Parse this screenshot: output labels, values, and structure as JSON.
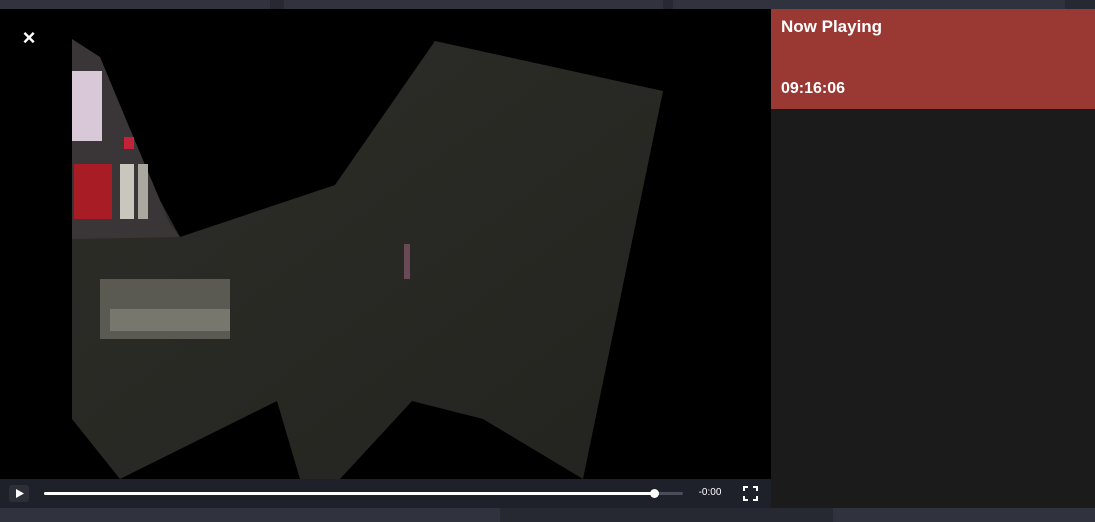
{
  "player": {
    "close_label": "×",
    "time_remaining": "-0:00",
    "progress": 0.955,
    "colors": {
      "controls_bg": "#1e2129",
      "track": "#4a4e5a",
      "fill": "#ffffff"
    },
    "icons": {
      "close": "close-icon",
      "play": "play-icon",
      "fullscreen": "fullscreen-icon"
    }
  },
  "side_panel": {
    "now_playing_label": "Now Playing",
    "time": "09:16:06",
    "colors": {
      "card": "#9a3834",
      "panel": "#1b1b1b"
    }
  }
}
